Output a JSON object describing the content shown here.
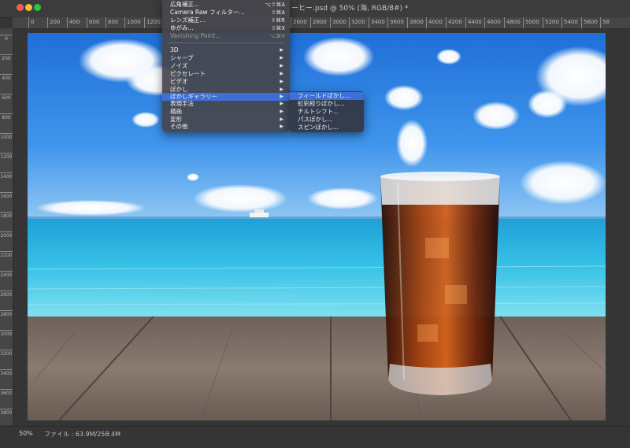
{
  "window": {
    "document_title": "ーヒー.psd @ 50% (海, RGB/8#) *"
  },
  "ruler": {
    "h_ticks": [
      "0",
      "200",
      "400",
      "600",
      "800",
      "1000",
      "1200",
      "2600",
      "2800",
      "3000",
      "3200",
      "3400",
      "3600",
      "3800",
      "4000",
      "4200",
      "4400",
      "4600",
      "4800",
      "5000",
      "5200",
      "5400",
      "5600",
      "58"
    ],
    "v_ticks": [
      "0",
      "200",
      "400",
      "600",
      "800",
      "1000",
      "1200",
      "1400",
      "1600",
      "1800",
      "2000",
      "2200",
      "2400",
      "2600",
      "2800",
      "3000",
      "3200",
      "3400",
      "3600",
      "3800"
    ]
  },
  "filter_menu": {
    "items": [
      {
        "label": "広角補正...",
        "shortcut": "⌥⇧⌘A"
      },
      {
        "label": "Camera Raw フィルター...",
        "shortcut": "⇧⌘A"
      },
      {
        "label": "レンズ補正...",
        "shortcut": "⇧⌘R"
      },
      {
        "label": "ゆがみ...",
        "shortcut": "⇧⌘X"
      },
      {
        "label": "Vanishing Point...",
        "shortcut": "⌥⌘V"
      }
    ],
    "submenus": [
      {
        "label": "3D",
        "arrow": "▶"
      },
      {
        "label": "シャープ",
        "arrow": "▶"
      },
      {
        "label": "ノイズ",
        "arrow": "▶"
      },
      {
        "label": "ピクセレート",
        "arrow": "▶"
      },
      {
        "label": "ビデオ",
        "arrow": "▶"
      },
      {
        "label": "ぼかし",
        "arrow": "▶"
      },
      {
        "label": "ぼかしギャラリー",
        "arrow": "▶"
      },
      {
        "label": "表現手法",
        "arrow": "▶"
      },
      {
        "label": "描画",
        "arrow": "▶"
      },
      {
        "label": "変形",
        "arrow": "▶"
      },
      {
        "label": "その他",
        "arrow": "▶"
      }
    ]
  },
  "blur_gallery_menu": {
    "items": [
      "フィールドぼかし...",
      "虹彩絞りぼかし...",
      "チルトシフト...",
      "パスぼかし...",
      "スピンぼかし..."
    ]
  },
  "status": {
    "zoom": "50%",
    "file": "ファイル : 63.9M/256.4M",
    "arrow": "›"
  },
  "colors": {
    "menu_highlight": "#3d6fd6",
    "close": "#fe5f57",
    "minimize": "#febc2e",
    "zoom": "#28c840"
  }
}
